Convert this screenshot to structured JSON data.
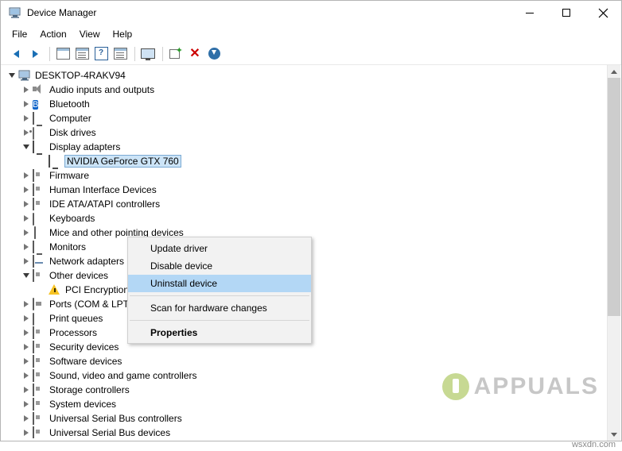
{
  "window": {
    "title": "Device Manager",
    "title_icon": "device-manager-icon",
    "minimize": "─",
    "maximize": "□",
    "close": "✕"
  },
  "menubar": {
    "items": [
      {
        "label": "File"
      },
      {
        "label": "Action"
      },
      {
        "label": "View"
      },
      {
        "label": "Help"
      }
    ]
  },
  "toolbar": {
    "buttons": [
      {
        "name": "back-button",
        "icon": "arrow-left-icon"
      },
      {
        "name": "forward-button",
        "icon": "arrow-right-icon"
      },
      {
        "name": "show-hide-console-tree-button",
        "icon": "tree-pane-icon"
      },
      {
        "name": "properties-button",
        "icon": "properties-icon"
      },
      {
        "name": "help-button",
        "icon": "question-mark-icon"
      },
      {
        "name": "device-view-button",
        "icon": "device-list-icon"
      },
      {
        "name": "monitor-button",
        "icon": "monitor-icon"
      },
      {
        "name": "scan-hardware-changes-button",
        "icon": "scan-hardware-icon"
      },
      {
        "name": "uninstall-device-button",
        "icon": "red-x-icon"
      },
      {
        "name": "update-driver-button",
        "icon": "download-arrow-icon"
      }
    ]
  },
  "tree": {
    "root": {
      "label": "DESKTOP-4RAKV94",
      "icon": "computer-icon",
      "expanded": true
    },
    "items": [
      {
        "label": "Audio inputs and outputs",
        "icon": "speaker-icon",
        "indent": 1,
        "expandable": true,
        "expanded": false
      },
      {
        "label": "Bluetooth",
        "icon": "bluetooth-icon",
        "indent": 1,
        "expandable": true,
        "expanded": false
      },
      {
        "label": "Computer",
        "icon": "computer-icon",
        "indent": 1,
        "expandable": true,
        "expanded": false
      },
      {
        "label": "Disk drives",
        "icon": "disk-drive-icon",
        "indent": 1,
        "expandable": true,
        "expanded": false
      },
      {
        "label": "Display adapters",
        "icon": "display-adapter-icon",
        "indent": 1,
        "expandable": true,
        "expanded": true
      },
      {
        "label": "NVIDIA GeForce GTX 760",
        "icon": "display-adapter-icon",
        "indent": 2,
        "expandable": false,
        "expanded": false,
        "selected": true
      },
      {
        "label": "Firmware",
        "icon": "chip-icon",
        "indent": 1,
        "expandable": true,
        "expanded": false
      },
      {
        "label": "Human Interface Devices",
        "icon": "hid-icon",
        "indent": 1,
        "expandable": true,
        "expanded": false
      },
      {
        "label": "IDE ATA/ATAPI controllers",
        "icon": "controller-icon",
        "indent": 1,
        "expandable": true,
        "expanded": false
      },
      {
        "label": "Keyboards",
        "icon": "keyboard-icon",
        "indent": 1,
        "expandable": true,
        "expanded": false
      },
      {
        "label": "Mice and other pointing devices",
        "icon": "mouse-icon",
        "indent": 1,
        "expandable": true,
        "expanded": false
      },
      {
        "label": "Monitors",
        "icon": "monitor-icon",
        "indent": 1,
        "expandable": true,
        "expanded": false
      },
      {
        "label": "Network adapters",
        "icon": "network-adapter-icon",
        "indent": 1,
        "expandable": true,
        "expanded": false
      },
      {
        "label": "Other devices",
        "icon": "other-devices-icon",
        "indent": 1,
        "expandable": true,
        "expanded": true
      },
      {
        "label": "PCI Encryption/Decryption Controller",
        "icon": "warning-icon",
        "indent": 2,
        "expandable": false,
        "expanded": false
      },
      {
        "label": "Ports (COM & LPT)",
        "icon": "port-icon",
        "indent": 1,
        "expandable": true,
        "expanded": false
      },
      {
        "label": "Print queues",
        "icon": "printer-icon",
        "indent": 1,
        "expandable": true,
        "expanded": false
      },
      {
        "label": "Processors",
        "icon": "processor-icon",
        "indent": 1,
        "expandable": true,
        "expanded": false
      },
      {
        "label": "Security devices",
        "icon": "security-icon",
        "indent": 1,
        "expandable": true,
        "expanded": false
      },
      {
        "label": "Software devices",
        "icon": "software-device-icon",
        "indent": 1,
        "expandable": true,
        "expanded": false
      },
      {
        "label": "Sound, video and game controllers",
        "icon": "sound-icon",
        "indent": 1,
        "expandable": true,
        "expanded": false
      },
      {
        "label": "Storage controllers",
        "icon": "storage-controller-icon",
        "indent": 1,
        "expandable": true,
        "expanded": false
      },
      {
        "label": "System devices",
        "icon": "system-device-icon",
        "indent": 1,
        "expandable": true,
        "expanded": false
      },
      {
        "label": "Universal Serial Bus controllers",
        "icon": "usb-controller-icon",
        "indent": 1,
        "expandable": true,
        "expanded": false
      },
      {
        "label": "Universal Serial Bus devices",
        "icon": "usb-device-icon",
        "indent": 1,
        "expandable": true,
        "expanded": false
      }
    ]
  },
  "context_menu": {
    "items": [
      {
        "label": "Update driver",
        "highlighted": false,
        "bold": false
      },
      {
        "label": "Disable device",
        "highlighted": false,
        "bold": false
      },
      {
        "label": "Uninstall device",
        "highlighted": true,
        "bold": false
      },
      {
        "separator": true
      },
      {
        "label": "Scan for hardware changes",
        "highlighted": false,
        "bold": false
      },
      {
        "separator": true
      },
      {
        "label": "Properties",
        "highlighted": false,
        "bold": true
      }
    ]
  },
  "watermark": {
    "brand": "APPUALS",
    "footer": "wsxdn.com"
  },
  "colors": {
    "selection": "#cce4f7",
    "menu_highlight": "#b3d7f5",
    "accent_blue": "#1a6fb5",
    "warning_yellow": "#f6c324",
    "brand_green": "#9bbb3c"
  }
}
